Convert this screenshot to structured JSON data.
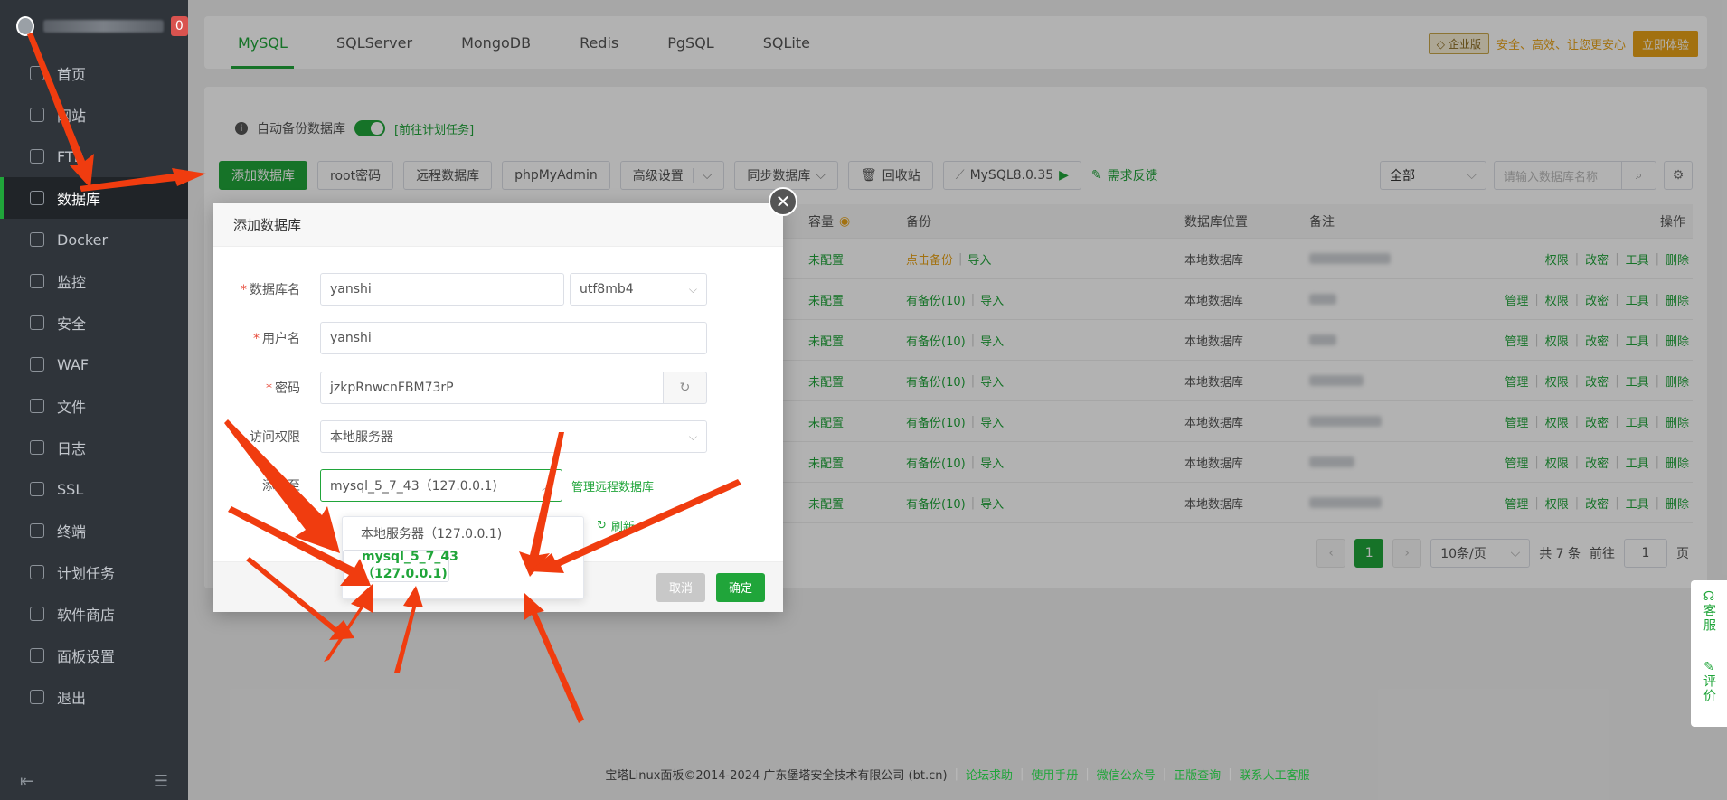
{
  "sidebar": {
    "badge": "0",
    "items": [
      {
        "label": "首页",
        "icon": "home-icon"
      },
      {
        "label": "网站",
        "icon": "globe-icon"
      },
      {
        "label": "FTP",
        "icon": "ftp-icon"
      },
      {
        "label": "数据库",
        "icon": "database-icon"
      },
      {
        "label": "Docker",
        "icon": "docker-icon"
      },
      {
        "label": "监控",
        "icon": "monitor-icon"
      },
      {
        "label": "安全",
        "icon": "shield-icon"
      },
      {
        "label": "WAF",
        "icon": "waf-icon"
      },
      {
        "label": "文件",
        "icon": "folder-icon"
      },
      {
        "label": "日志",
        "icon": "log-icon"
      },
      {
        "label": "SSL",
        "icon": "ssl-icon"
      },
      {
        "label": "终端",
        "icon": "terminal-icon"
      },
      {
        "label": "计划任务",
        "icon": "calendar-icon"
      },
      {
        "label": "软件商店",
        "icon": "store-icon"
      },
      {
        "label": "面板设置",
        "icon": "gear-icon"
      },
      {
        "label": "退出",
        "icon": "logout-icon"
      }
    ]
  },
  "tabs": [
    "MySQL",
    "SQLServer",
    "MongoDB",
    "Redis",
    "PgSQL",
    "SQLite"
  ],
  "promo": {
    "badge": "企业版",
    "text": "安全、高效、让您更安心",
    "button": "立即体验"
  },
  "backup": {
    "label": "自动备份数据库",
    "link": "[前往计划任务]"
  },
  "toolbar": {
    "add": "添加数据库",
    "root": "root密码",
    "remote": "远程数据库",
    "pma": "phpMyAdmin",
    "advanced": "高级设置",
    "sync": "同步数据库",
    "recycle": "回收站",
    "mysql_ver": "MySQL8.0.35",
    "feedback": "需求反馈",
    "filter": "全部",
    "search_placeholder": "请输入数据库名称"
  },
  "table": {
    "headers": {
      "cap": "容量",
      "backup": "备份",
      "location": "数据库位置",
      "note": "备注",
      "ops": "操作"
    },
    "rows": [
      {
        "cap": "未配置",
        "backup_a": "点击备份",
        "backup_b": "导入",
        "loc": "本地数据库",
        "ops": [
          "权限",
          "改密",
          "工具",
          "删除"
        ]
      },
      {
        "cap": "未配置",
        "backup_a": "有备份(10)",
        "backup_b": "导入",
        "loc": "本地数据库",
        "ops": [
          "管理",
          "权限",
          "改密",
          "工具",
          "删除"
        ]
      },
      {
        "cap": "未配置",
        "backup_a": "有备份(10)",
        "backup_b": "导入",
        "loc": "本地数据库",
        "ops": [
          "管理",
          "权限",
          "改密",
          "工具",
          "删除"
        ]
      },
      {
        "cap": "未配置",
        "backup_a": "有备份(10)",
        "backup_b": "导入",
        "loc": "本地数据库",
        "ops": [
          "管理",
          "权限",
          "改密",
          "工具",
          "删除"
        ]
      },
      {
        "cap": "未配置",
        "backup_a": "有备份(10)",
        "backup_b": "导入",
        "loc": "本地数据库",
        "ops": [
          "管理",
          "权限",
          "改密",
          "工具",
          "删除"
        ]
      },
      {
        "cap": "未配置",
        "backup_a": "有备份(10)",
        "backup_b": "导入",
        "loc": "本地数据库",
        "ops": [
          "管理",
          "权限",
          "改密",
          "工具",
          "删除"
        ]
      },
      {
        "cap": "未配置",
        "backup_a": "有备份(10)",
        "backup_b": "导入",
        "loc": "本地数据库",
        "ops": [
          "管理",
          "权限",
          "改密",
          "工具",
          "删除"
        ]
      }
    ]
  },
  "pager": {
    "current": "1",
    "per_page": "10条/页",
    "total": "共 7 条",
    "goto": "前往",
    "goto_val": "1",
    "page_suffix": "页"
  },
  "footer": {
    "copyright": "宝塔Linux面板©2014-2024 广东堡塔安全技术有限公司 (bt.cn)",
    "links": [
      "论坛求助",
      "使用手册",
      "微信公众号",
      "正版查询",
      "联系人工客服"
    ]
  },
  "float": {
    "service": "客服",
    "review": "评价"
  },
  "dialog": {
    "title": "添加数据库",
    "dbname_label": "数据库名",
    "dbname": "yanshi",
    "charset": "utf8mb4",
    "user_label": "用户名",
    "user": "yanshi",
    "pwd_label": "密码",
    "pwd": "jzkpRnwcnFBM73rP",
    "access_label": "访问权限",
    "access": "本地服务器",
    "addto_label": "添加至",
    "addto": "mysql_5_7_43（127.0.0.1)",
    "manage_remote": "管理远程数据库",
    "refresh": "刷新",
    "options": [
      "本地服务器（127.0.0.1)",
      "mysql_5_7_43（127.0.0.1)"
    ],
    "cancel": "取消",
    "ok": "确定"
  },
  "accent": "#20a53a",
  "annotation_color": "#f03c0f"
}
